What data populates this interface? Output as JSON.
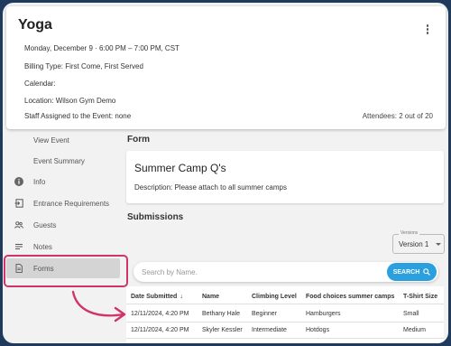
{
  "event": {
    "title": "Yoga",
    "date_time": "Monday, December 9  ·  6:00 PM – 7:00 PM, CST",
    "billing_type": "Billing Type: First Come, First Served",
    "calendar": "Calendar:",
    "location": "Location: Wilson Gym Demo",
    "staff": "Staff Assigned to the Event: none",
    "attendees": "Attendees: 2 out of 20"
  },
  "sidebar": {
    "items": [
      {
        "label": "View Event",
        "icon": ""
      },
      {
        "label": "Event Summary",
        "icon": ""
      },
      {
        "label": "Info",
        "icon": "info-icon"
      },
      {
        "label": "Entrance Requirements",
        "icon": "entrance-icon"
      },
      {
        "label": "Guests",
        "icon": "guests-icon"
      },
      {
        "label": "Notes",
        "icon": "notes-icon"
      },
      {
        "label": "Forms",
        "icon": "forms-icon"
      }
    ]
  },
  "form": {
    "section_title": "Form",
    "name": "Summer Camp Q's",
    "description": "Description: Please attach to all summer camps"
  },
  "submissions": {
    "section_title": "Submissions",
    "version_caption": "Versions",
    "version_value": "Version 1",
    "search_placeholder": "Search by Name.",
    "search_button": "SEARCH",
    "columns": [
      "Date Submitted",
      "Name",
      "Climbing Level",
      "Food choices summer camps",
      "T-Shirt Size"
    ],
    "rows": [
      [
        "12/11/2024, 4:20 PM",
        "Bethany Hale",
        "Beginner",
        "Hamburgers",
        "Small"
      ],
      [
        "12/11/2024, 4:20 PM",
        "Skyler Kessler",
        "Intermediate",
        "Hotdogs",
        "Medium"
      ]
    ]
  },
  "colors": {
    "accent": "#2aa0de",
    "highlight": "#d0356a",
    "background": "#1f3a5c"
  }
}
